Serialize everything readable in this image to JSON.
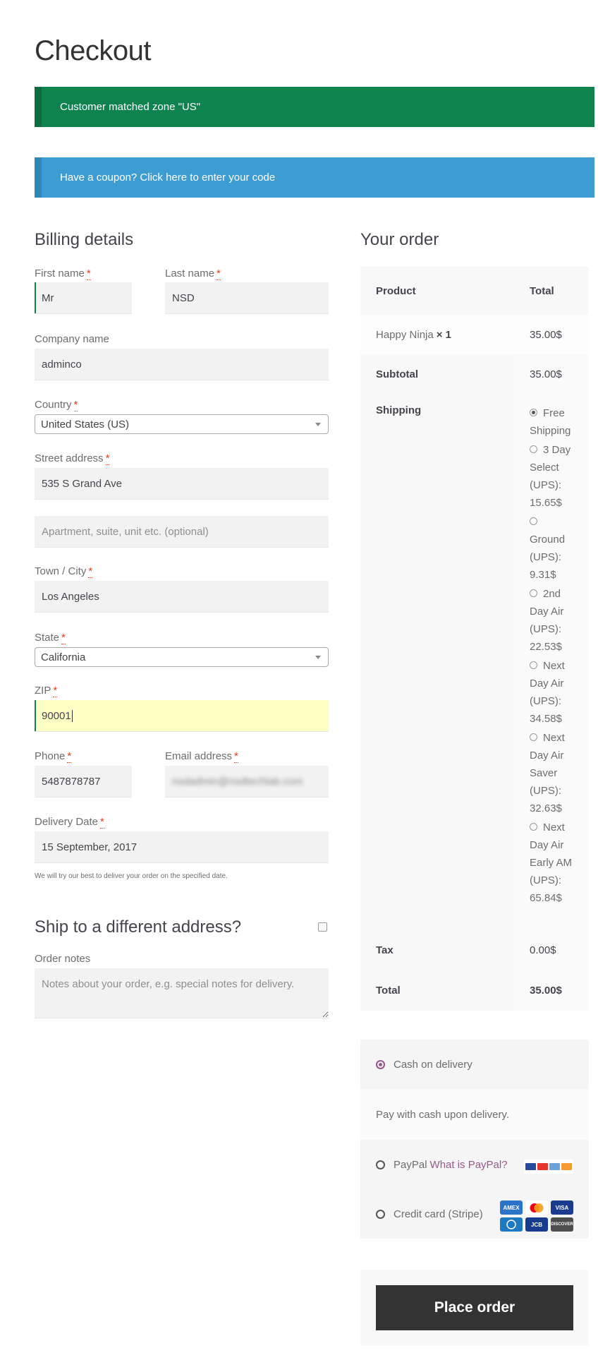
{
  "page": {
    "title": "Checkout"
  },
  "notices": {
    "zone": "Customer matched zone \"US\"",
    "coupon": "Have a coupon? Click here to enter your code"
  },
  "billing": {
    "heading": "Billing details",
    "required_mark": "*",
    "first_name": {
      "label": "First name",
      "value": "Mr"
    },
    "last_name": {
      "label": "Last name",
      "value": "NSD"
    },
    "company": {
      "label": "Company name",
      "value": "adminco"
    },
    "country": {
      "label": "Country",
      "value": "United States (US)"
    },
    "street": {
      "label": "Street address",
      "value": "535 S Grand Ave",
      "apt_placeholder": "Apartment, suite, unit etc. (optional)"
    },
    "city": {
      "label": "Town / City",
      "value": "Los Angeles"
    },
    "state": {
      "label": "State",
      "value": "California"
    },
    "zip": {
      "label": "ZIP",
      "value": "90001"
    },
    "phone": {
      "label": "Phone",
      "value": "5487878787"
    },
    "email": {
      "label": "Email address",
      "value": "nsdadmin@nsdtechlab.com"
    },
    "delivery_date": {
      "label": "Delivery Date",
      "value": "15 September, 2017",
      "hint": "We will try our best to deliver your order on the specified date."
    }
  },
  "shipping_section": {
    "heading": "Ship to a different address?",
    "order_notes_label": "Order notes",
    "order_notes_placeholder": "Notes about your order, e.g. special notes for delivery."
  },
  "order": {
    "heading": "Your order",
    "col_product": "Product",
    "col_total": "Total",
    "item_name": "Happy Ninja",
    "item_qty": "× 1",
    "item_total": "35.00$",
    "subtotal_label": "Subtotal",
    "subtotal": "35.00$",
    "shipping_label": "Shipping",
    "shipping_options": [
      {
        "lines": [
          "Free",
          "Shipping"
        ],
        "selected": true
      },
      {
        "lines": [
          "3 Day",
          "Select",
          "(UPS):",
          "15.65$"
        ],
        "selected": false
      },
      {
        "lines": [
          "",
          "Ground",
          "(UPS):",
          "9.31$"
        ],
        "selected": false
      },
      {
        "lines": [
          "2nd",
          "Day Air",
          "(UPS):",
          "22.53$"
        ],
        "selected": false
      },
      {
        "lines": [
          "Next",
          "Day Air",
          "(UPS):",
          "34.58$"
        ],
        "selected": false
      },
      {
        "lines": [
          "Next",
          "Day Air",
          "Saver",
          "(UPS):",
          "32.63$"
        ],
        "selected": false
      },
      {
        "lines": [
          "Next",
          "Day Air",
          "Early AM",
          "(UPS):",
          "65.84$"
        ],
        "selected": false
      }
    ],
    "tax_label": "Tax",
    "tax": "0.00$",
    "total_label": "Total",
    "total": "35.00$"
  },
  "payment": {
    "cod_label": "Cash on delivery",
    "cod_desc": "Pay with cash upon delivery.",
    "paypal_label": "PayPal",
    "paypal_link": "What is PayPal?",
    "stripe_label": "Credit card (Stripe)",
    "card_icons": [
      "amex-icon",
      "mastercard-icon",
      "visa-icon",
      "diners-icon",
      "jcb-icon",
      "discover-icon"
    ],
    "place_order": "Place order"
  },
  "colors": {
    "success": "#0f834d",
    "info": "#3d9cd2",
    "button": "#333333",
    "accent": "#96588a"
  }
}
